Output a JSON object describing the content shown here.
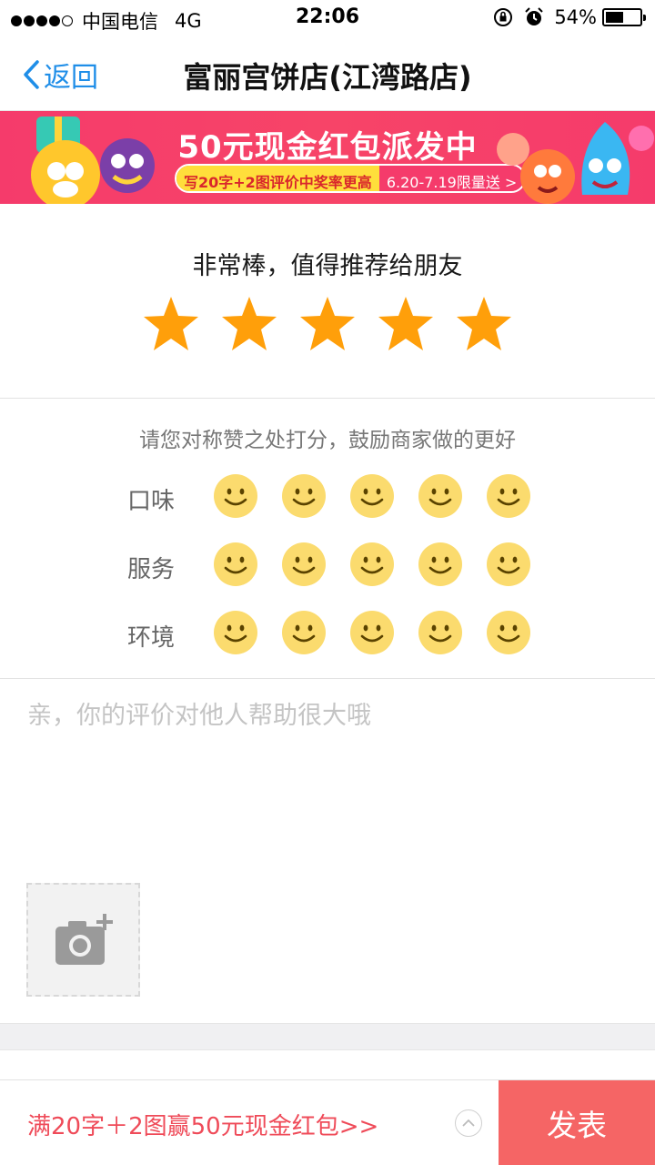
{
  "status_bar": {
    "carrier": "中国电信",
    "network": "4G",
    "time": "22:06",
    "battery": "54%",
    "battery_level": 0.54
  },
  "nav": {
    "back_label": "返回",
    "title": "富丽宫饼店(江湾路店)"
  },
  "banner": {
    "title": "50元现金红包派发中",
    "sub_left": "写20字+2图评价中奖率更高",
    "sub_right": "6.20-7.19限量送 >"
  },
  "rating": {
    "text": "非常棒，值得推荐给朋友",
    "stars_filled": 5,
    "stars_total": 5,
    "star_color": "#ff9f0a"
  },
  "sub_rating": {
    "hint": "请您对称赞之处打分，鼓励商家做的更好",
    "rows": [
      {
        "label": "口味"
      },
      {
        "label": "服务"
      },
      {
        "label": "环境"
      }
    ],
    "smiley_color": "#fbdb6e"
  },
  "comment": {
    "placeholder": "亲，你的评价对他人帮助很大哦"
  },
  "bottom": {
    "promo": "满20字＋2图赢50元现金红包>>",
    "publish": "发表",
    "publish_color": "#f56565"
  }
}
